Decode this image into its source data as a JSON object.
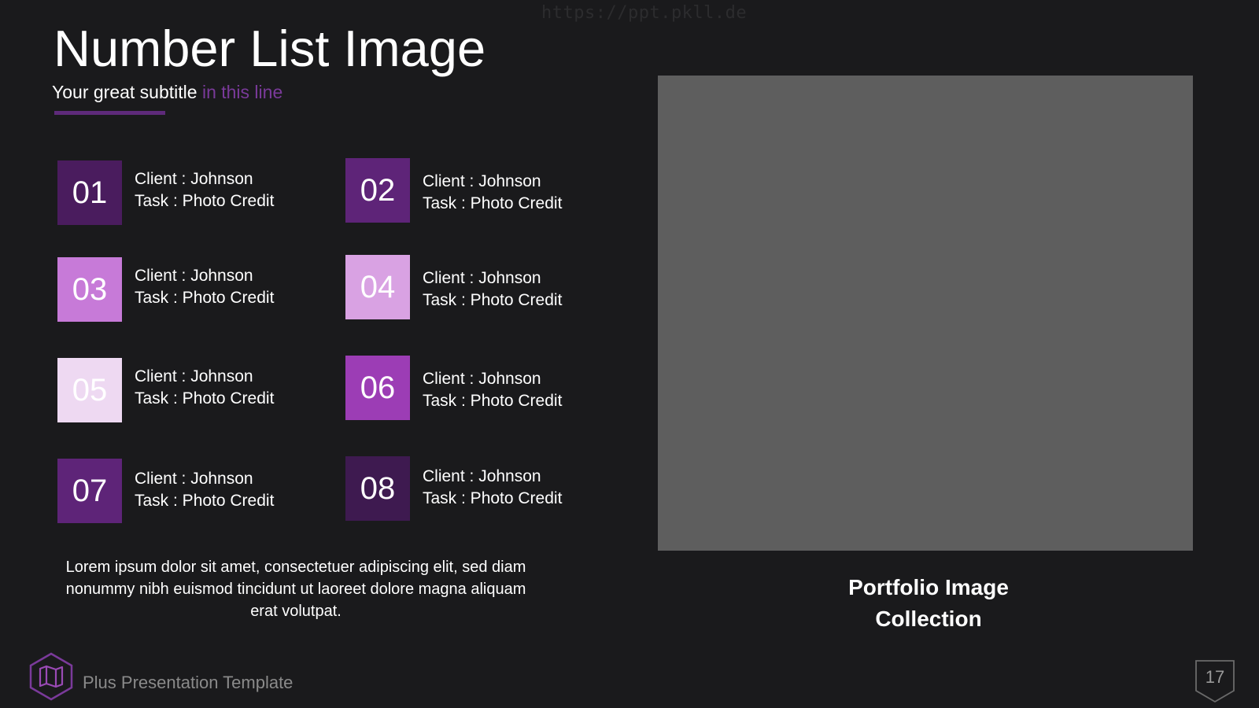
{
  "watermark": "https://ppt.pkll.de",
  "title": "Number List Image",
  "subtitle": {
    "main": "Your great subtitle ",
    "accent": "in this line"
  },
  "items": [
    {
      "number": "01",
      "client": "Client : Johnson",
      "task": "Task : Photo Credit",
      "color": "#4a1c5e"
    },
    {
      "number": "02",
      "client": "Client : Johnson",
      "task": "Task : Photo Credit",
      "color": "#5e2478"
    },
    {
      "number": "03",
      "client": "Client : Johnson",
      "task": "Task : Photo Credit",
      "color": "#c77ad8"
    },
    {
      "number": "04",
      "client": "Client : Johnson",
      "task": "Task : Photo Credit",
      "color": "#d9a2e3"
    },
    {
      "number": "05",
      "client": "Client : Johnson",
      "task": "Task : Photo Credit",
      "color": "#eed9f2"
    },
    {
      "number": "06",
      "client": "Client : Johnson",
      "task": "Task : Photo Credit",
      "color": "#9c3db5"
    },
    {
      "number": "07",
      "client": "Client : Johnson",
      "task": "Task : Photo Credit",
      "color": "#5e2478"
    },
    {
      "number": "08",
      "client": "Client : Johnson",
      "task": "Task : Photo Credit",
      "color": "#3e1a50"
    }
  ],
  "body_text": "Lorem ipsum dolor sit amet, consectetuer adipiscing elit, sed diam nonummy nibh euismod tincidunt ut laoreet dolore magna aliquam erat volutpat.",
  "image_caption": {
    "line1": "Portfolio Image",
    "line2": "Collection"
  },
  "footer": {
    "text": "Plus Presentation Template",
    "logo_icon": "map-icon",
    "page_number": "17"
  },
  "colors": {
    "background": "#1a1a1c",
    "accent": "#7a3a9a",
    "underline": "#5e2a7a",
    "placeholder": "#5e5e5e"
  }
}
